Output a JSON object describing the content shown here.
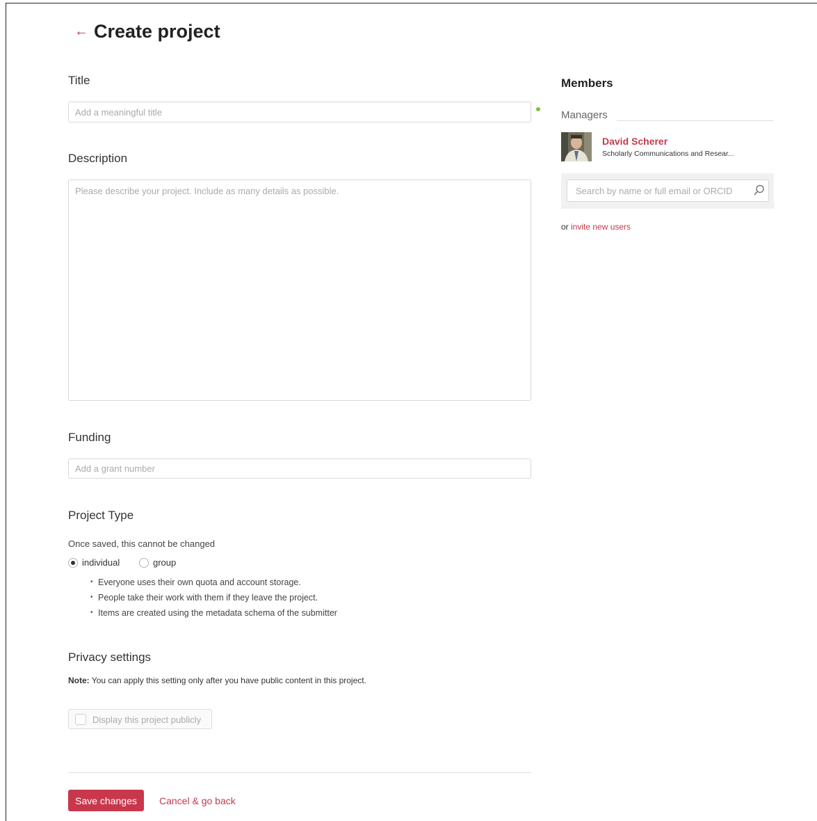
{
  "header": {
    "back_icon": "left-arrow-icon",
    "title": "Create project"
  },
  "form": {
    "title": {
      "label": "Title",
      "placeholder": "Add a meaningful title",
      "value": ""
    },
    "description": {
      "label": "Description",
      "placeholder": "Please describe your project. Include as many details as possible.",
      "value": ""
    },
    "funding": {
      "label": "Funding",
      "placeholder": "Add a grant number",
      "value": ""
    },
    "project_type": {
      "label": "Project Type",
      "hint": "Once saved, this cannot be changed",
      "options": [
        {
          "label": "individual",
          "selected": true
        },
        {
          "label": "group",
          "selected": false
        }
      ],
      "bullets": [
        "Everyone uses their own quota and account storage.",
        "People take their work with them if they leave the project.",
        "Items are created using the metadata schema of the submitter"
      ]
    },
    "privacy": {
      "label": "Privacy settings",
      "note_prefix": "Note:",
      "note_text": " You can apply this setting only after you have public content in this project.",
      "checkbox_label": "Display this project publicly",
      "checked": false,
      "disabled": true
    }
  },
  "actions": {
    "save_label": "Save changes",
    "cancel_label": "Cancel & go back"
  },
  "members": {
    "title": "Members",
    "managers_label": "Managers",
    "managers": [
      {
        "name": "David Scherer",
        "affiliation": "Scholarly Communications and Resear..."
      }
    ],
    "search_placeholder": "Search by name or full email or ORCID",
    "invite_prefix": "or ",
    "invite_link": "invite new users"
  },
  "colors": {
    "accent": "#c9374d",
    "required_dot": "#7ec142"
  }
}
